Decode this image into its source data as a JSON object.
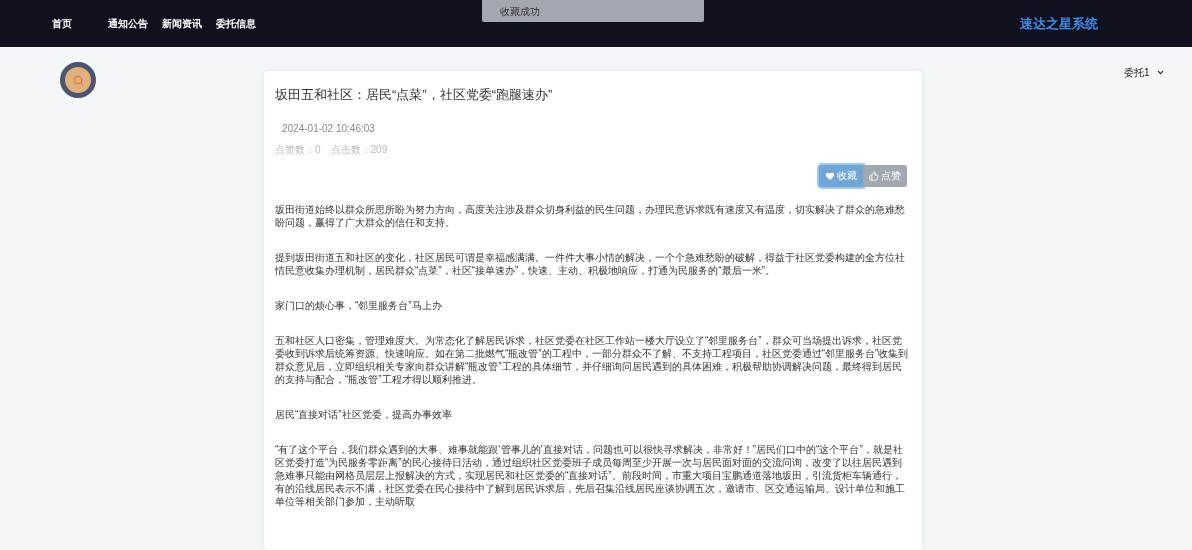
{
  "nav": {
    "items": [
      "首页",
      "通知公告",
      "新闻资讯",
      "委托信息"
    ],
    "brand": "速达之星系统"
  },
  "toast": {
    "text": "收藏成功"
  },
  "user_menu": {
    "label": "委托1"
  },
  "article": {
    "title": "坂田五和社区：居民“点菜”，社区党委“跑腿速办”",
    "date": "2024-01-02 10:46:03",
    "likes": "点赞数：0",
    "clicks": "点击数：209",
    "buttons": [
      {
        "kind": "favorite",
        "label": "收藏"
      },
      {
        "kind": "like",
        "label": "点赞"
      }
    ],
    "paragraphs": [
      "坂田街道始终以群众所思所盼为努力方向，高度关注涉及群众切身利益的民生问题，办理民意诉求既有速度又有温度，切实解决了群众的急难愁盼问题，赢得了广大群众的信任和支持。",
      "提到坂田街道五和社区的变化，社区居民可谓是幸福感满满。一件件大事小情的解决，一个个急难愁盼的破解，得益于社区党委构建的全方位社情民意收集办理机制，居民群众“点菜”，社区“接单速办”，快速、主动、积极地响应，打通为民服务的“最后一米”。",
      "家门口的烦心事，“邻里服务台”马上办",
      "五和社区人口密集，管理难度大。为常态化了解居民诉求，社区党委在社区工作站一楼大厅设立了“邻里服务台”，群众可当场提出诉求，社区党委收到诉求后统筹资源、快速响应。如在第二批燃气“瓶改管”的工程中，一部分群众不了解、不支持工程项目，社区党委通过“邻里服务台”收集到群众意见后，立即组织相关专家向群众讲解“瓶改管”工程的具体细节，并仔细询问居民遇到的具体困难，积极帮助协调解决问题，最终得到居民的支持与配合，“瓶改管”工程才得以顺利推进。",
      "居民“直接对话”社区党委，提高办事效率",
      "“有了这个平台，我们群众遇到的大事、难事就能跟‘管事儿的’直接对话，问题也可以很快寻求解决，非常好！”居民们口中的“这个平台”，就是社区党委打造“为民服务零距离”的民心接待日活动，通过组织社区党委班子成员每周至少开展一次与居民面对面的交流问询，改变了以往居民遇到急难事只能由网格员层层上报解决的方式，实现居民和社区党委的“直接对话”。前段时间，市重大项目宝鹏通道落地坂田，引流货柜车辆通行，有的沿线居民表示不满，社区党委在民心接待中了解到居民诉求后，先后召集沿线居民座谈协调五次，邀请市、区交通运输局、设计单位和施工单位等相关部门参加，主动听取"
    ]
  }
}
